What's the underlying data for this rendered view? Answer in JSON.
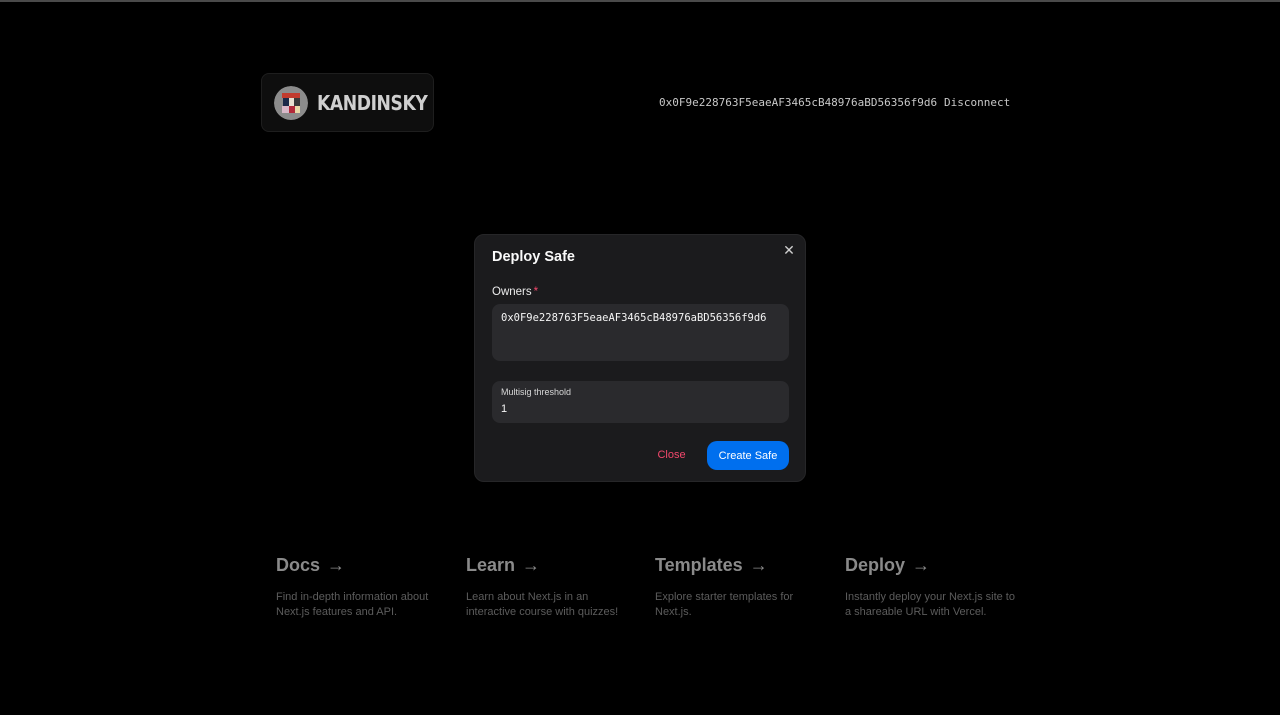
{
  "header": {
    "brand": "KANDINSKY",
    "wallet_address": "0x0F9e228763F5eaeAF3465cB48976aBD56356f9d6",
    "disconnect_label": "Disconnect"
  },
  "modal": {
    "title": "Deploy Safe",
    "close_icon": "close-icon",
    "owners_label": "Owners",
    "owners_required_mark": "*",
    "owners_value": "0x0F9e228763F5eaeAF3465cB48976aBD56356f9d6",
    "threshold_label": "Multisig threshold",
    "threshold_value": "1",
    "close_label": "Close",
    "create_label": "Create Safe"
  },
  "cards": [
    {
      "title": "Docs",
      "arrow": "→",
      "description": "Find in-depth information about Next.js features and API."
    },
    {
      "title": "Learn",
      "arrow": "→",
      "description": "Learn about Next.js in an interactive course with quizzes!"
    },
    {
      "title": "Templates",
      "arrow": "→",
      "description": "Explore starter templates for Next.js."
    },
    {
      "title": "Deploy",
      "arrow": "→",
      "description": "Instantly deploy your Next.js site to a shareable URL with Vercel."
    }
  ],
  "colors": {
    "primary": "#006fee",
    "danger": "#f3486c",
    "modal_bg": "#1b1b1d",
    "field_bg": "#2a2a2d"
  }
}
